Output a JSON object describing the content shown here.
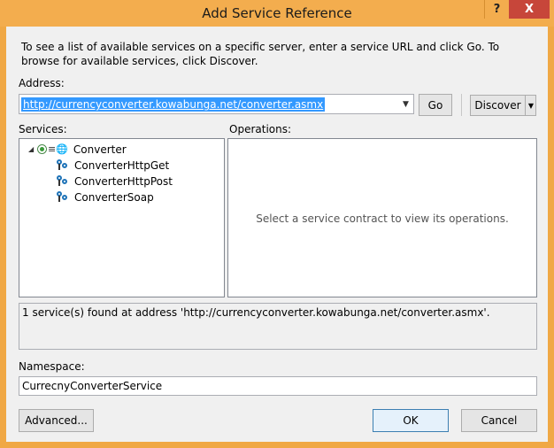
{
  "window": {
    "title": "Add Service Reference",
    "help_glyph": "?",
    "close_glyph": "X"
  },
  "intro_text": "To see a list of available services on a specific server, enter a service URL and click Go. To browse for available services, click Discover.",
  "address": {
    "label": "Address:",
    "value": "http://currencyconverter.kowabunga.net/converter.asmx"
  },
  "buttons": {
    "go": "Go",
    "discover": "Discover",
    "advanced": "Advanced...",
    "ok": "OK",
    "cancel": "Cancel"
  },
  "services": {
    "label": "Services:",
    "root": "Converter",
    "children": [
      "ConverterHttpGet",
      "ConverterHttpPost",
      "ConverterSoap"
    ]
  },
  "operations": {
    "label": "Operations:",
    "empty_message": "Select a service contract to view its operations."
  },
  "status_text": "1 service(s) found at address 'http://currencyconverter.kowabunga.net/converter.asmx'.",
  "namespace": {
    "label": "Namespace:",
    "value": "CurrecnyConverterService"
  },
  "colors": {
    "title_bar": "#f3ad4e",
    "close_button": "#c7463a",
    "selection": "#3399ff",
    "endpoint_icon": "#1e73b8"
  }
}
